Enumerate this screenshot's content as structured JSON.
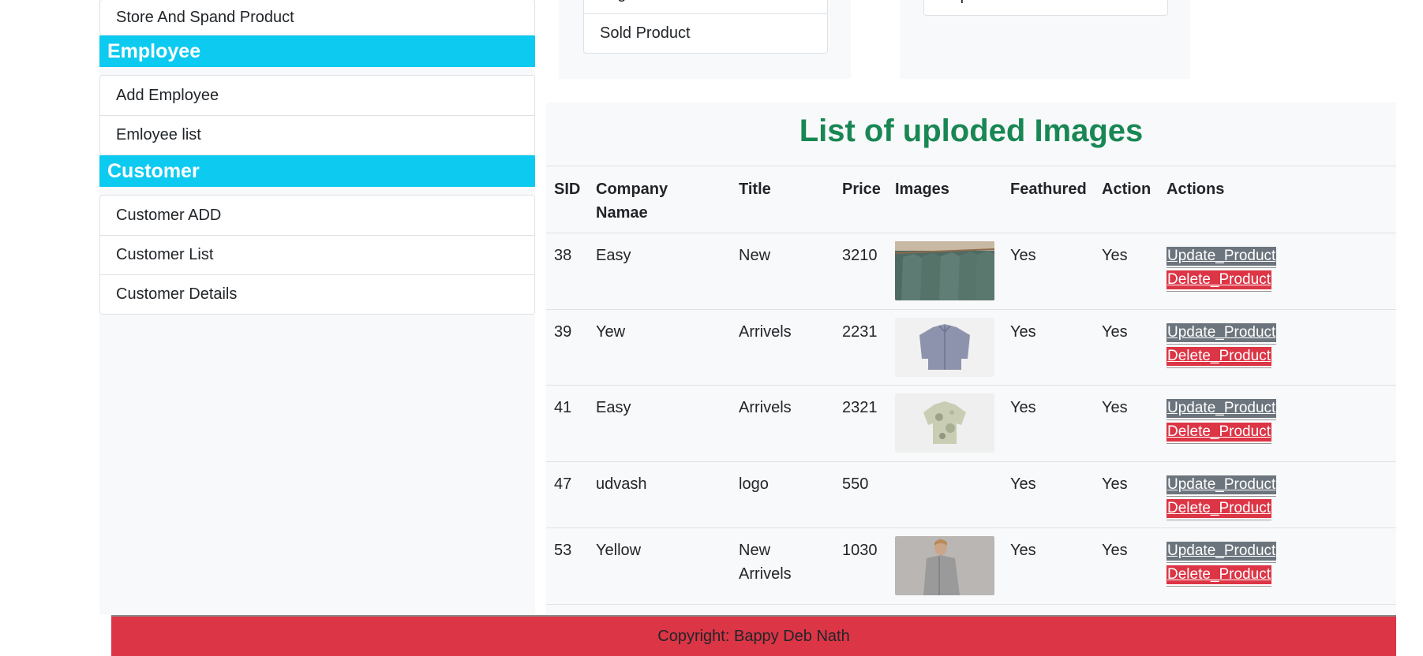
{
  "sidebar": {
    "store_group": {
      "items": [
        "Store And Spand Product"
      ]
    },
    "employee_header": "Employee",
    "employee_items": [
      "Add Employee",
      "Emloyee list"
    ],
    "customer_header": "Customer",
    "customer_items": [
      "Customer ADD",
      "Customer List",
      "Customer Details"
    ]
  },
  "top_left_card": {
    "items": [
      "Login",
      "Sold Product"
    ]
  },
  "top_right_card": {
    "items": [
      "Report"
    ]
  },
  "images_section": {
    "title": "List of uploded Images",
    "columns": [
      "SID",
      "Company Namae",
      "Title",
      "Price",
      "Images",
      "Feathured",
      "Action",
      "Actions"
    ],
    "rows": [
      {
        "sid": "38",
        "company": "Easy",
        "title": "New",
        "price": "3210",
        "image": "green-tshirts-on-hangers",
        "featured": "Yes",
        "action": "Yes"
      },
      {
        "sid": "39",
        "company": "Yew",
        "title": "Arrivels",
        "price": "2231",
        "image": "blue-shirt",
        "featured": "Yes",
        "action": "Yes"
      },
      {
        "sid": "41",
        "company": "Easy",
        "title": "Arrivels",
        "price": "2321",
        "image": "camouflage-shirt",
        "featured": "Yes",
        "action": "Yes"
      },
      {
        "sid": "47",
        "company": "udvash",
        "title": "logo",
        "price": "550",
        "image": "",
        "featured": "Yes",
        "action": "Yes"
      },
      {
        "sid": "53",
        "company": "Yellow",
        "title": "New Arrivels",
        "price": "1030",
        "image": "model-grey-jacket",
        "featured": "Yes",
        "action": "Yes"
      }
    ],
    "update_label": "Update_Product",
    "delete_label": "Delete_Product"
  },
  "footer": {
    "text": "Copyright: Bappy Deb Nath"
  },
  "colors": {
    "section_header": "#0dcaf0",
    "title_green": "#198754",
    "update_button": "#6c757d",
    "delete_button": "#dc3545",
    "footer_bg": "#dc3545"
  }
}
